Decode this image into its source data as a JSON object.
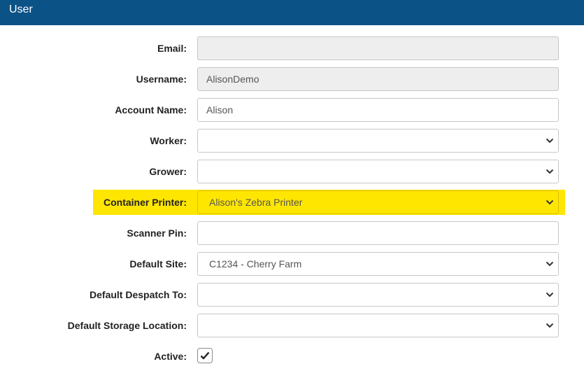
{
  "header": {
    "title": "User"
  },
  "form": {
    "email": {
      "label": "Email:",
      "value": ""
    },
    "username": {
      "label": "Username:",
      "value": "AlisonDemo"
    },
    "account_name": {
      "label": "Account Name:",
      "value": "Alison"
    },
    "worker": {
      "label": "Worker:",
      "value": ""
    },
    "grower": {
      "label": "Grower:",
      "value": ""
    },
    "container_printer": {
      "label": "Container Printer:",
      "value": "Alison's Zebra Printer"
    },
    "scanner_pin": {
      "label": "Scanner Pin:",
      "value": ""
    },
    "default_site": {
      "label": "Default Site:",
      "value": "C1234 - Cherry Farm"
    },
    "default_despatch": {
      "label": "Default Despatch To:",
      "value": ""
    },
    "default_storage": {
      "label": "Default Storage Location:",
      "value": ""
    },
    "active": {
      "label": "Active:",
      "checked": true
    }
  },
  "colors": {
    "header": "#0b5386",
    "highlight": "#ffe600"
  },
  "icons": {
    "select": "chevron-down-icon",
    "check": "checkmark-icon"
  }
}
